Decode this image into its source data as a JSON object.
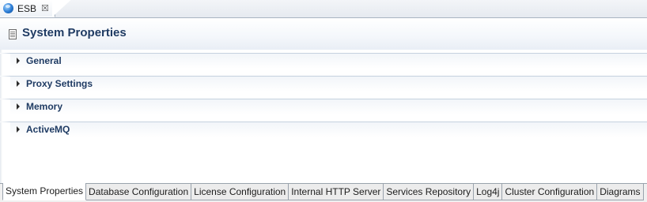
{
  "editor_tab": {
    "label": "ESB",
    "icon": "esb-globe-icon",
    "close_icon": "close-icon",
    "close_glyph": "☒"
  },
  "form": {
    "title": "System Properties",
    "title_icon": "document-icon"
  },
  "sections": [
    {
      "label": "General",
      "expanded": false
    },
    {
      "label": "Proxy Settings",
      "expanded": false
    },
    {
      "label": "Memory",
      "expanded": false
    },
    {
      "label": "ActiveMQ",
      "expanded": false
    }
  ],
  "page_tabs": [
    {
      "label": "System Properties",
      "active": true
    },
    {
      "label": "Database Configuration",
      "active": false
    },
    {
      "label": "License Configuration",
      "active": false
    },
    {
      "label": "Internal HTTP Server",
      "active": false
    },
    {
      "label": "Services Repository",
      "active": false
    },
    {
      "label": "Log4j",
      "active": false
    },
    {
      "label": "Cluster Configuration",
      "active": false
    },
    {
      "label": "Diagrams",
      "active": false
    }
  ],
  "colors": {
    "title": "#1f3b63",
    "section_label": "#1f3b63",
    "section_border": "#c5d1df",
    "tab_border": "#9aa3ad"
  }
}
